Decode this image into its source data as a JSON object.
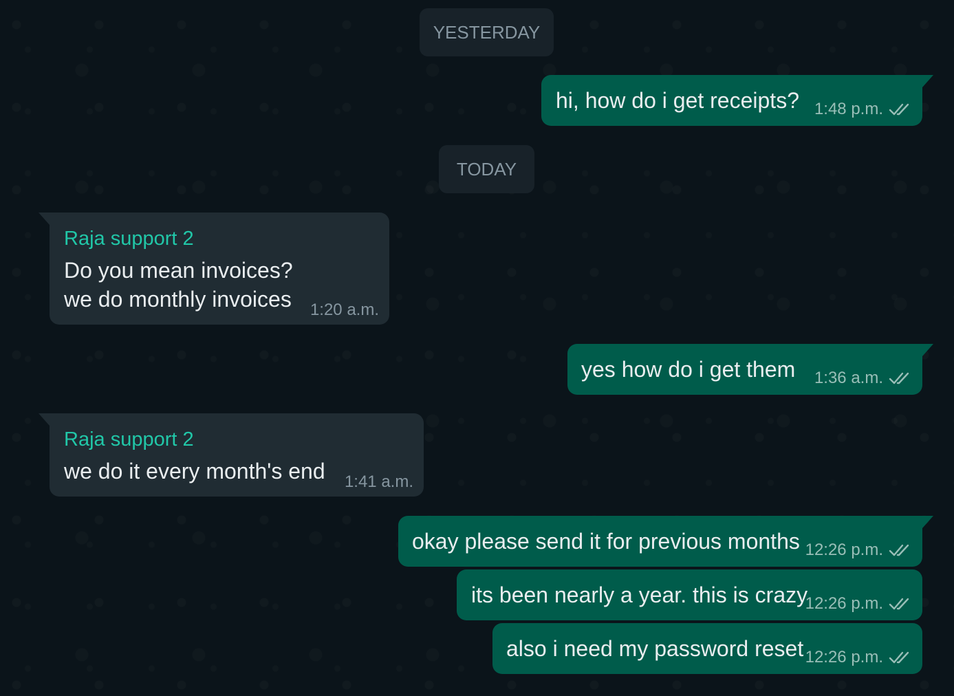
{
  "date_separators": [
    "YESTERDAY",
    "TODAY"
  ],
  "messages": [
    {
      "direction": "out",
      "text": "hi, how do i get receipts?",
      "time": "1:48 p.m.",
      "status_icon": "double-check-icon"
    },
    {
      "direction": "in",
      "sender": "Raja support 2",
      "lines": [
        "Do you mean invoices?",
        "we do monthly invoices"
      ],
      "time": "1:20 a.m."
    },
    {
      "direction": "out",
      "text": "yes how do i get them",
      "time": "1:36 a.m.",
      "status_icon": "double-check-icon"
    },
    {
      "direction": "in",
      "sender": "Raja support 2",
      "lines": [
        "we do it every month's end"
      ],
      "time": "1:41 a.m."
    },
    {
      "direction": "out",
      "text": "okay please send it for previous months",
      "time": "12:26 p.m.",
      "status_icon": "double-check-icon"
    },
    {
      "direction": "out",
      "text": "its been nearly a year. this is crazy",
      "time": "12:26 p.m.",
      "status_icon": "double-check-icon"
    },
    {
      "direction": "out",
      "text": "also i need my password reset",
      "time": "12:26 p.m.",
      "status_icon": "double-check-icon"
    }
  ],
  "colors": {
    "background": "#0b141a",
    "outgoing_bubble": "#005c4b",
    "incoming_bubble": "#202c33",
    "sender_name": "#21c7a8",
    "read_tick": "#99beb7"
  }
}
